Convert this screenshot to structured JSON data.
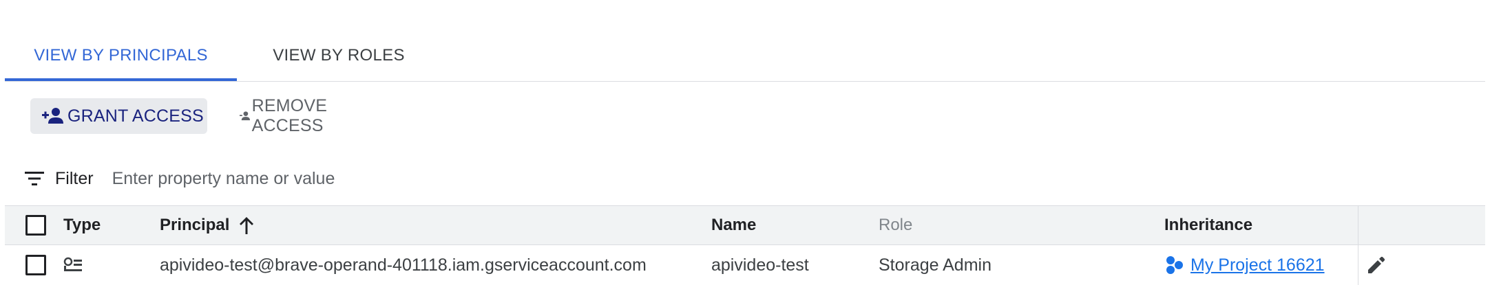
{
  "tabs": [
    {
      "label": "VIEW BY PRINCIPALS",
      "active": true
    },
    {
      "label": "VIEW BY ROLES",
      "active": false
    }
  ],
  "actions": {
    "grant_label": "GRANT ACCESS",
    "remove_label": "REMOVE ACCESS"
  },
  "filter": {
    "label": "Filter",
    "placeholder": "Enter property name or value"
  },
  "table": {
    "columns": {
      "type": "Type",
      "principal": "Principal",
      "name": "Name",
      "role": "Role",
      "inheritance": "Inheritance"
    },
    "sort": {
      "column": "principal",
      "direction": "ascending",
      "icon": "arrow-up-icon"
    },
    "rows": [
      {
        "type_icon": "service-account-icon",
        "principal": "apivideo-test@brave-operand-401118.iam.gserviceaccount.com",
        "name": "apivideo-test",
        "role": "Storage Admin",
        "inheritance": "My Project 16621",
        "inheritance_icon": "project-icon",
        "action_icon": "pencil-icon"
      }
    ]
  },
  "colors": {
    "accent": "#3367d6",
    "link": "#1a73e8",
    "grant_button_bg": "#e8eaed",
    "grant_button_text": "#1a237e"
  }
}
